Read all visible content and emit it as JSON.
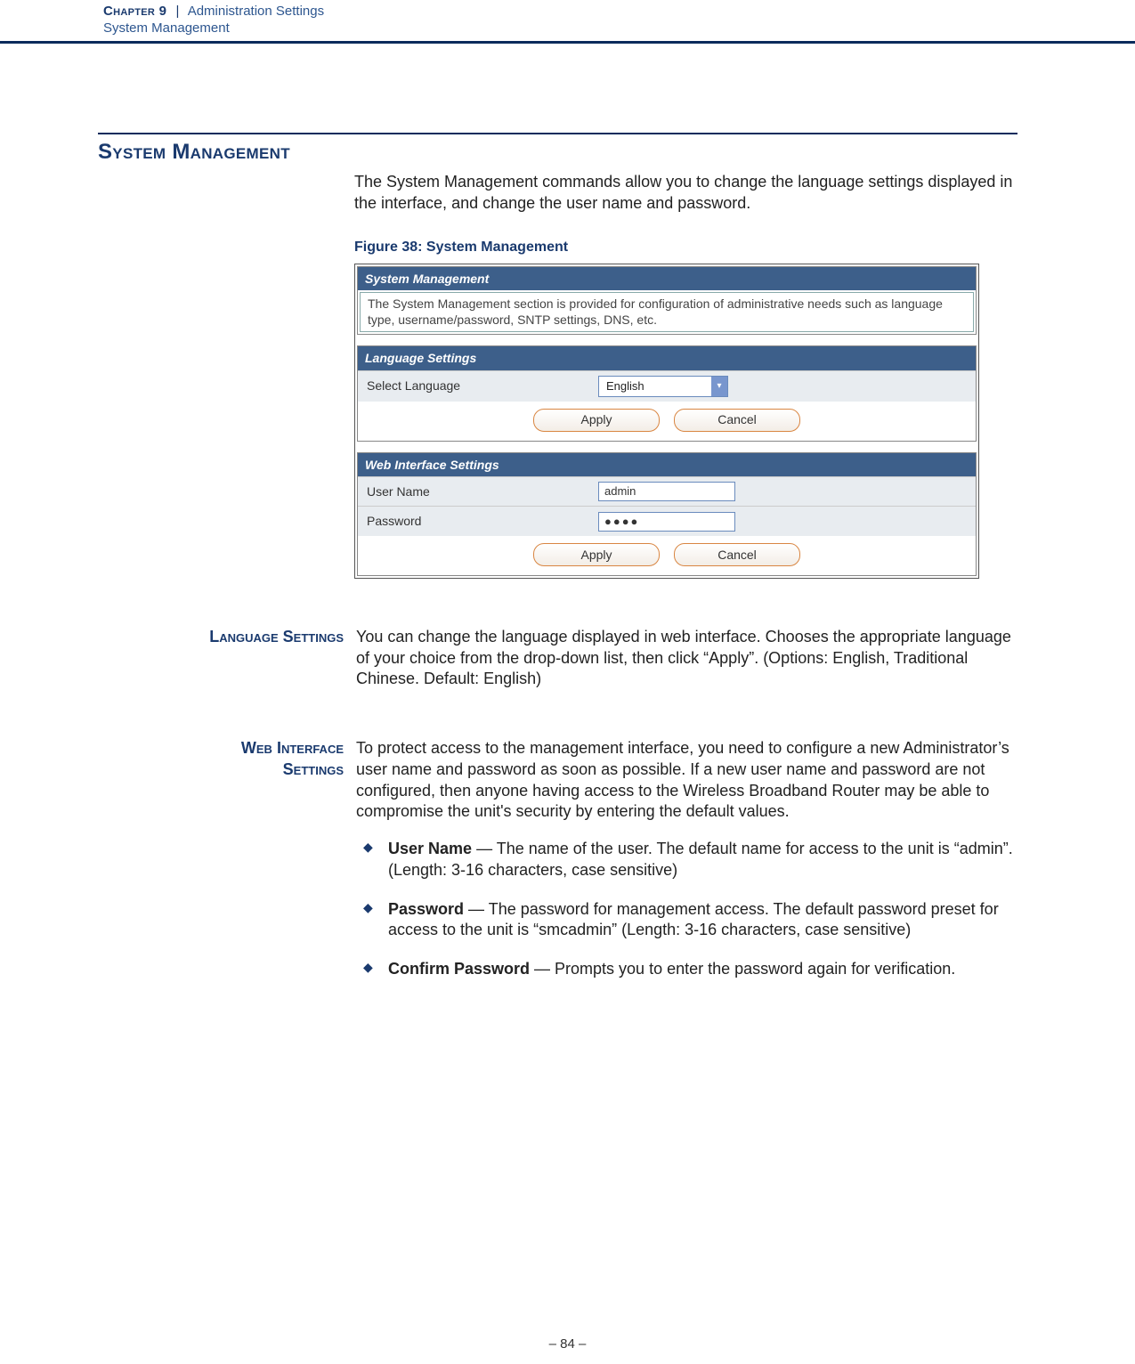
{
  "header": {
    "chapter_label": "Chapter 9",
    "separator": "|",
    "chapter_title": "Administration Settings",
    "subtitle": "System Management"
  },
  "section_heading": "System Management",
  "intro_para": "The System Management commands allow you to change the language settings displayed in the interface, and change the user name and password.",
  "figure_caption": "Figure 38:  System Management",
  "screenshot": {
    "sysmgmt_title": "System Management",
    "sysmgmt_desc": "The System Management section is provided for configuration of administrative needs such as language type, username/password, SNTP settings, DNS, etc.",
    "lang_title": "Language Settings",
    "lang_label": "Select Language",
    "lang_value": "English",
    "apply": "Apply",
    "cancel": "Cancel",
    "web_title": "Web Interface Settings",
    "user_label": "User Name",
    "user_value": "admin",
    "pass_label": "Password",
    "pass_value": "●●●●"
  },
  "lang_side": "Language Settings",
  "lang_para": "You can change the language displayed in web interface. Chooses the appropriate language of your choice from the drop-down list, then click “Apply”. (Options: English, Traditional Chinese. Default: English)",
  "web_side_l1": "Web Interface",
  "web_side_l2": "Settings",
  "web_para": "To protect access to the management interface, you need to configure a new Administrator’s user name and password as soon as possible. If a new user name and password are not configured, then anyone having access to the Wireless Broadband Router may be able to compromise the unit's security by entering the default values.",
  "bullets": {
    "user_label": "User Name",
    "user_text": " — The name of the user. The default name for access to the unit is “admin”. (Length: 3-16 characters, case sensitive)",
    "pass_label": "Password",
    "pass_text": " — The password for management access. The default password preset for access to the unit is “smcadmin” (Length: 3-16 characters, case sensitive)",
    "conf_label": "Confirm Password",
    "conf_text": " — Prompts you to enter the password again for verification."
  },
  "page_number": "–  84  –"
}
